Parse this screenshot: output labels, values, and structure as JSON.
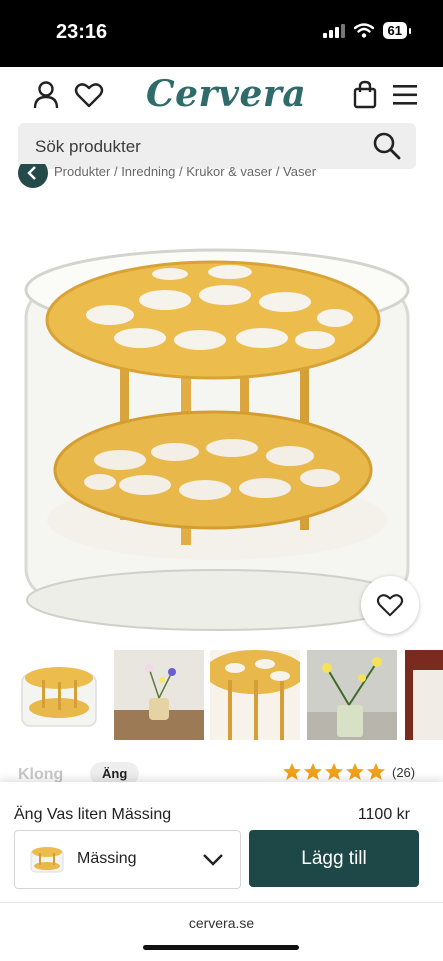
{
  "status_bar": {
    "time": "23:16",
    "battery": "61"
  },
  "header": {
    "logo": "Cervera",
    "icons": [
      "user-icon",
      "heart-icon",
      "bag-icon",
      "menu-icon"
    ]
  },
  "search": {
    "placeholder": "Sök produkter"
  },
  "breadcrumb": {
    "text": "Produkter / Inredning / Krukor & vaser / Vaser"
  },
  "gallery": {
    "thumbnails": [
      "Gold frog vase in glass",
      "Vase with flowers on table",
      "Close-up of gold pin grid",
      "Vase with yellow flowers"
    ]
  },
  "product_meta": {
    "brand": "Klong",
    "tag": "Äng",
    "rating_stars": 5,
    "review_count": "(26)"
  },
  "purchase": {
    "product_name": "Äng Vas liten Mässing",
    "price": "1100 kr",
    "variant": "Mässing",
    "add_label": "Lägg till"
  },
  "browser": {
    "url": "cervera.se"
  },
  "colors": {
    "brand": "#2e6b6a",
    "cta": "#1e4747",
    "gold": "#e8b84a",
    "stars": "#f0a11a"
  }
}
